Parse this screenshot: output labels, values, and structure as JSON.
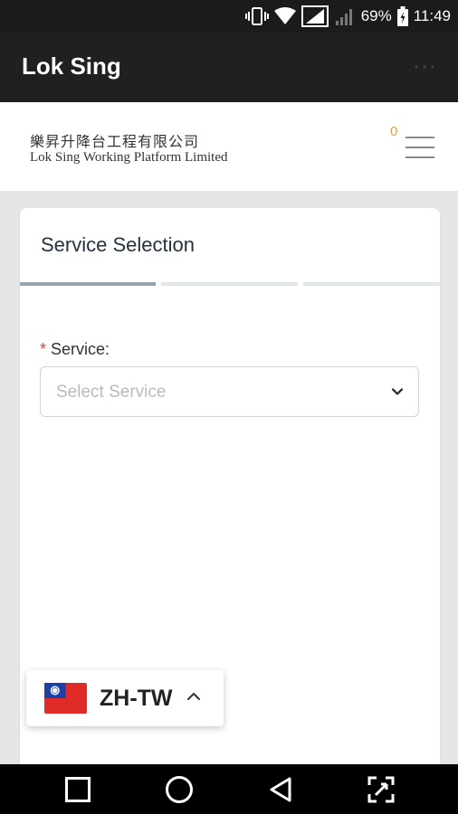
{
  "status_bar": {
    "battery": "69%",
    "time": "11:49",
    "icons": [
      "vibrate-icon",
      "wifi-icon",
      "signal-icon",
      "signal-icon",
      "battery-icon"
    ]
  },
  "app_bar": {
    "title": "Lok Sing",
    "more_icon": "more-icon"
  },
  "header": {
    "logo_cn": "樂昇升降台工程有限公司",
    "logo_en": "Lok Sing Working Platform Limited",
    "cart_count": "0",
    "menu_icon": "hamburger-menu-icon",
    "accent_color": "#e8a33d"
  },
  "card": {
    "title": "Service Selection",
    "steps": [
      {
        "state": "active"
      },
      {
        "state": "inactive"
      },
      {
        "state": "inactive"
      }
    ],
    "field": {
      "required_mark": "*",
      "label": "Service:",
      "placeholder": "Select Service"
    }
  },
  "language": {
    "code": "ZH-TW",
    "flag": "taiwan-flag",
    "caret": "chevron-up-icon"
  },
  "nav_bar": {
    "buttons": [
      "recent-apps-icon",
      "home-icon",
      "back-icon",
      "expand-icon"
    ]
  }
}
